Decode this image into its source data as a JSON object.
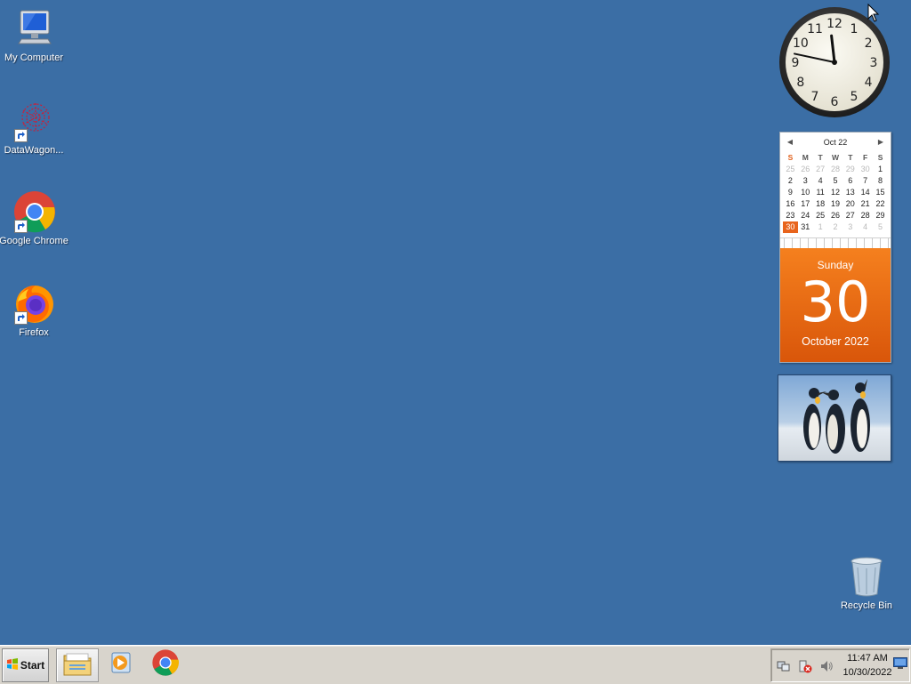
{
  "desktop": {
    "icons": [
      {
        "label": "My Computer"
      },
      {
        "label": "DataWagon..."
      },
      {
        "label": "Google Chrome"
      },
      {
        "label": "Firefox"
      }
    ],
    "recycle_bin": {
      "label": "Recycle Bin"
    },
    "background_color": "#3b6ea5"
  },
  "gadgets": {
    "clock": {
      "hour": 11,
      "minute": 47,
      "numerals": [
        "12",
        "1",
        "2",
        "3",
        "4",
        "5",
        "6",
        "7",
        "8",
        "9",
        "10",
        "11"
      ]
    },
    "calendar": {
      "month_label": "Oct 22",
      "weekday_headers": [
        "S",
        "M",
        "T",
        "W",
        "T",
        "F",
        "S"
      ],
      "weeks": [
        [
          "25",
          "26",
          "27",
          "28",
          "29",
          "30",
          "1"
        ],
        [
          "2",
          "3",
          "4",
          "5",
          "6",
          "7",
          "8"
        ],
        [
          "9",
          "10",
          "11",
          "12",
          "13",
          "14",
          "15"
        ],
        [
          "16",
          "17",
          "18",
          "19",
          "20",
          "21",
          "22"
        ],
        [
          "23",
          "24",
          "25",
          "26",
          "27",
          "28",
          "29"
        ],
        [
          "30",
          "31",
          "1",
          "2",
          "3",
          "4",
          "5"
        ]
      ],
      "today": "30",
      "day_of_week": "Sunday",
      "day_number": "30",
      "month_year": "October 2022",
      "accent_color": "#e8641c"
    },
    "slideshow": {
      "subject": "penguins-photo"
    }
  },
  "taskbar": {
    "start_label": "Start",
    "pinned": [
      {
        "name": "file-explorer-icon"
      },
      {
        "name": "media-player-icon"
      },
      {
        "name": "chrome-icon"
      }
    ],
    "tray": {
      "time": "11:47 AM",
      "date": "10/30/2022"
    }
  }
}
